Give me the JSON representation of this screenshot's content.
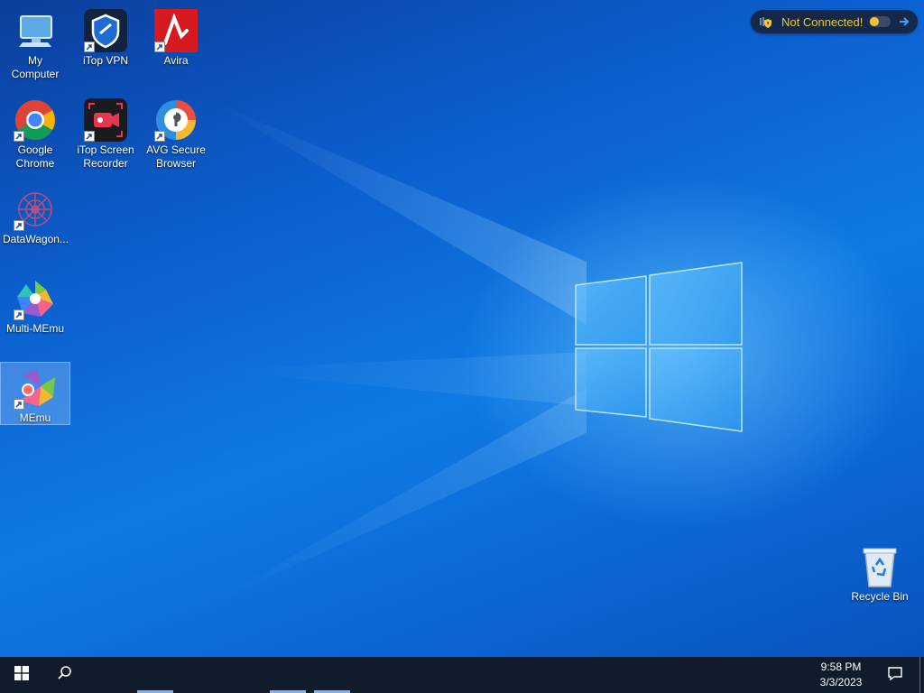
{
  "desktop": {
    "icons": [
      {
        "label": "My Computer"
      },
      {
        "label": "iTop VPN"
      },
      {
        "label": "Avira"
      },
      {
        "label": "Google Chrome"
      },
      {
        "label": "iTop Screen Recorder"
      },
      {
        "label": "AVG Secure Browser"
      },
      {
        "label": "DataWagon..."
      },
      {
        "label": "Multi-MEmu"
      },
      {
        "label": "MEmu"
      },
      {
        "label": "Recycle Bin"
      }
    ]
  },
  "vpn_widget": {
    "status": "Not Connected!",
    "status_color": "#f2c531"
  },
  "taskbar": {
    "time": "9:58 PM",
    "date": "3/3/2023"
  },
  "colors": {
    "taskbar_bg": "#101c2c",
    "accent": "#0c74e0"
  }
}
